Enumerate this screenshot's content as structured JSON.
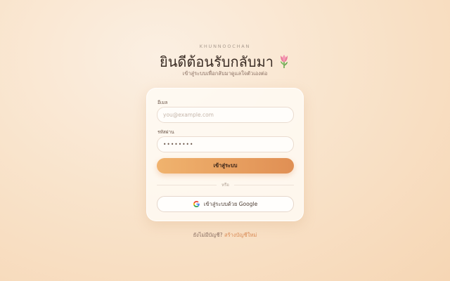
{
  "brand": "KHUNNOOCHAN",
  "header": {
    "title": "ยินดีต้อนรับกลับมา",
    "subtitle": "เข้าสู่ระบบเพื่อกลับมาดูแลใจตัวเองต่อ"
  },
  "form": {
    "email_label": "อีเมล",
    "email_placeholder": "you@example.com",
    "password_label": "รหัสผ่าน",
    "password_placeholder": "••••••••",
    "login_button": "เข้าสู่ระบบ",
    "divider_text": "หรือ",
    "google_button": "เข้าสู่ระบบด้วย Google"
  },
  "footer": {
    "prompt": "ยังไม่มีบัญชี?",
    "signup_link": "สร้างบัญชีใหม่"
  },
  "colors": {
    "accent_start": "#f0b36e",
    "accent_end": "#e08f54",
    "link": "#d98a54"
  },
  "icons": {
    "title_icon": "tulip-icon",
    "google_icon": "google-g-icon"
  }
}
